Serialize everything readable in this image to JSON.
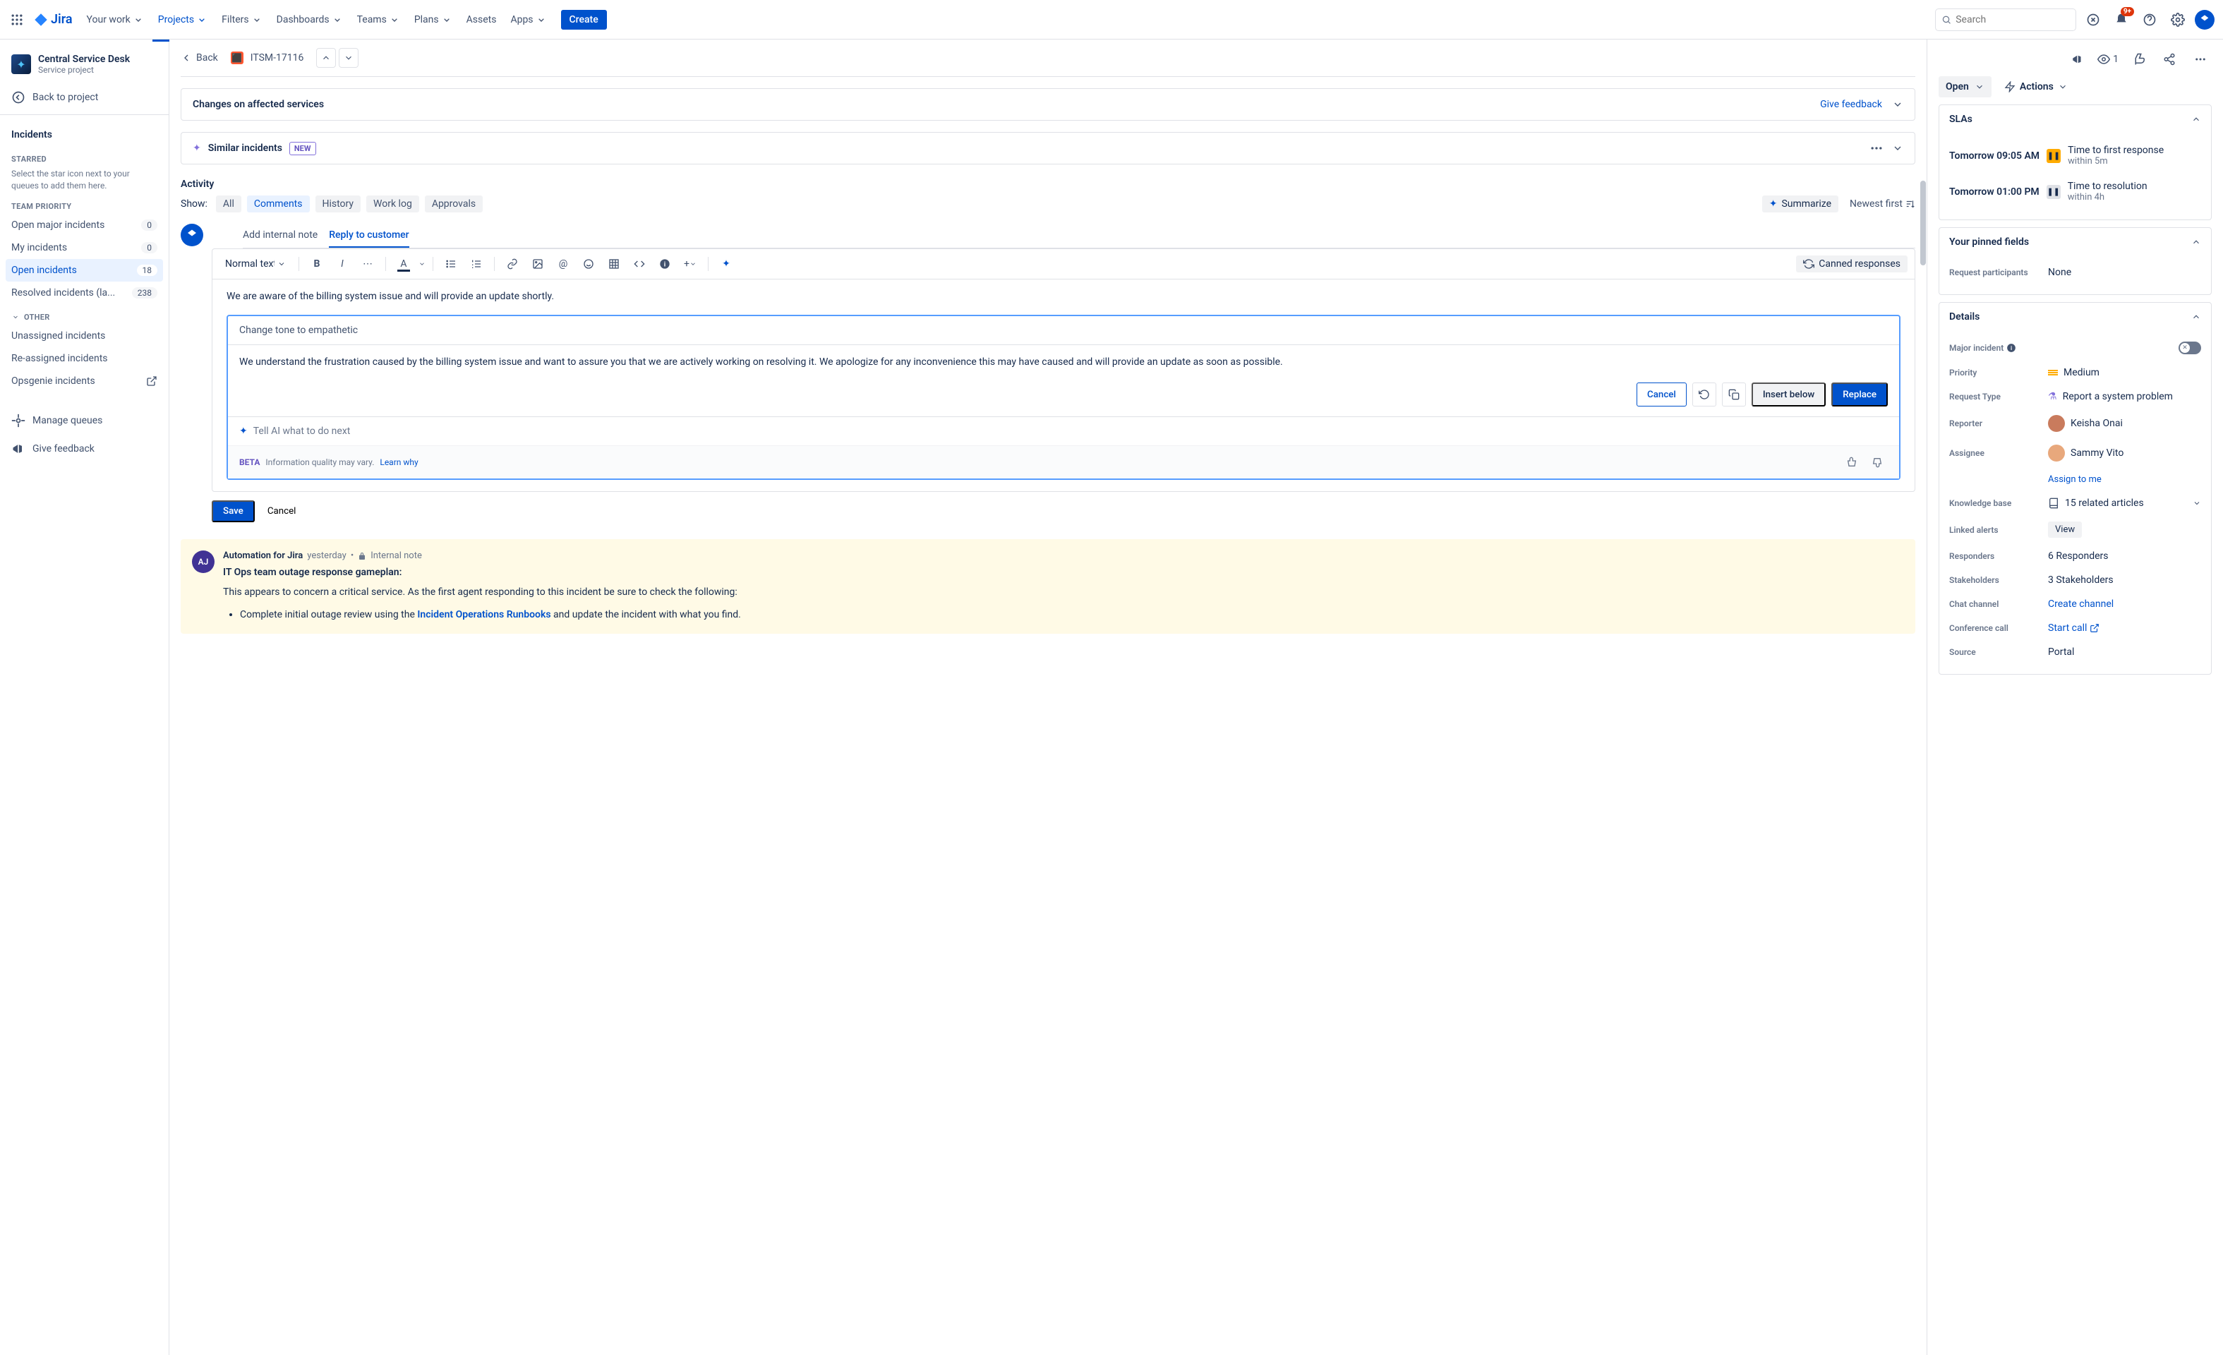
{
  "topnav": {
    "logo": "Jira",
    "items": [
      "Your work",
      "Projects",
      "Filters",
      "Dashboards",
      "Teams",
      "Plans",
      "Assets",
      "Apps"
    ],
    "create": "Create",
    "search_placeholder": "Search",
    "notif_badge": "9+"
  },
  "sidebar": {
    "project_name": "Central Service Desk",
    "project_type": "Service project",
    "back_to_project": "Back to project",
    "heading": "Incidents",
    "starred_label": "STARRED",
    "starred_helper": "Select the star icon next to your queues to add them here.",
    "team_priority_label": "TEAM PRIORITY",
    "other_label": "OTHER",
    "queues": [
      {
        "name": "Open major incidents",
        "count": "0"
      },
      {
        "name": "My incidents",
        "count": "0"
      },
      {
        "name": "Open incidents",
        "count": "18",
        "active": true
      },
      {
        "name": "Resolved incidents (la...",
        "count": "238"
      }
    ],
    "other_queues": [
      "Unassigned incidents",
      "Re-assigned incidents",
      "Opsgenie incidents"
    ],
    "manage_queues": "Manage queues",
    "give_feedback": "Give feedback"
  },
  "issue": {
    "back": "Back",
    "key": "ITSM-17116",
    "changes_title": "Changes on affected services",
    "give_feedback": "Give feedback",
    "similar": "Similar incidents",
    "new_lozenge": "NEW",
    "activity": {
      "title": "Activity",
      "show_label": "Show:",
      "tabs": [
        "All",
        "Comments",
        "History",
        "Work log",
        "Approvals"
      ],
      "summarize": "Summarize",
      "newest_first": "Newest first"
    },
    "comment_entry": {
      "add_note": "Add internal note",
      "reply_customer": "Reply to customer",
      "text_style": "Normal text",
      "canned": "Canned responses",
      "original": "We are aware of the billing system issue and will provide an update shortly.",
      "ai_prompt": "Change tone to empathetic",
      "ai_result": "We understand the frustration caused by the billing system issue and want to assure you that we are actively working on resolving it. We apologize for any inconvenience this may have caused and will provide an update as soon as possible.",
      "cancel": "Cancel",
      "insert_below": "Insert below",
      "replace": "Replace",
      "next_prompt": "Tell AI what to do next",
      "beta": "BETA",
      "info_quality": "Information quality may vary.",
      "learn_why": "Learn why",
      "save": "Save",
      "cancel2": "Cancel"
    },
    "internal_note": {
      "initials": "AJ",
      "author": "Automation for Jira",
      "time": "yesterday",
      "badge": "Internal note",
      "title": "IT Ops team outage response gameplan:",
      "text": "This appears to concern a critical service. As the first agent responding to this incident be sure to check the following:",
      "bullet_pre": "Complete initial outage review using the ",
      "bullet_link": "Incident Operations Runbooks",
      "bullet_post": " and update the incident with what you find."
    }
  },
  "details": {
    "watchers": "1",
    "status": "Open",
    "actions": "Actions",
    "slas_title": "SLAs",
    "slas": [
      {
        "due": "Tomorrow 09:05 AM",
        "label": "Time to first response",
        "sub": "within 5m",
        "warn": true
      },
      {
        "due": "Tomorrow 01:00 PM",
        "label": "Time to resolution",
        "sub": "within 4h",
        "warn": false
      }
    ],
    "pinned_title": "Your pinned fields",
    "request_participants_label": "Request participants",
    "request_participants_value": "None",
    "details_title": "Details",
    "fields": {
      "major_incident": "Major incident",
      "priority": "Priority",
      "priority_value": "Medium",
      "request_type": "Request Type",
      "request_type_value": "Report a system problem",
      "reporter": "Reporter",
      "reporter_value": "Keisha Onai",
      "assignee": "Assignee",
      "assignee_value": "Sammy Vito",
      "assign_to_me": "Assign to me",
      "kb": "Knowledge base",
      "kb_value": "15 related articles",
      "linked_alerts": "Linked alerts",
      "view": "View",
      "responders": "Responders",
      "responders_value": "6 Responders",
      "stakeholders": "Stakeholders",
      "stakeholders_value": "3 Stakeholders",
      "chat_channel": "Chat channel",
      "chat_channel_value": "Create channel",
      "conf_call": "Conference call",
      "conf_call_value": "Start call",
      "source": "Source",
      "source_value": "Portal"
    }
  }
}
